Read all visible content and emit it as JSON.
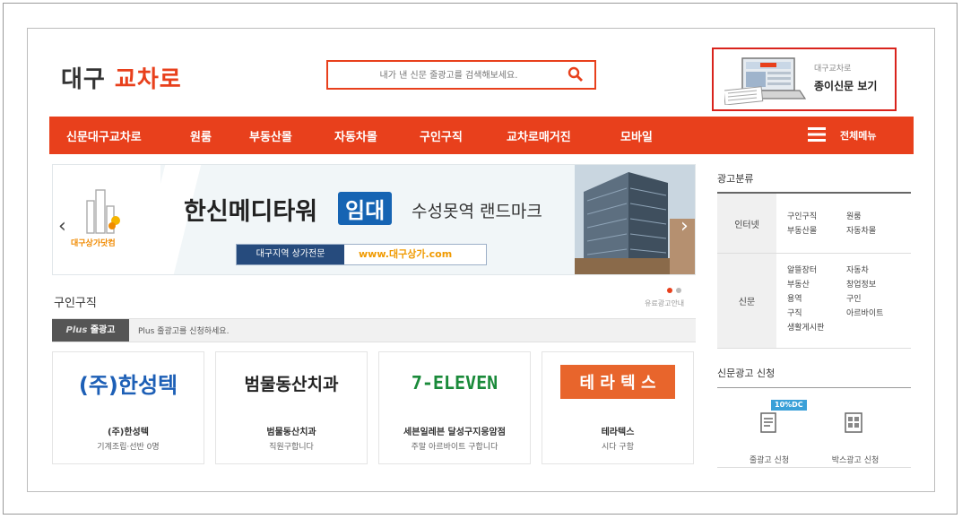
{
  "header": {
    "logo_part1": "대구",
    "logo_part2": "교차로",
    "search_placeholder": "내가 낸 신문 줄광고를 검색해보세요.",
    "paper_handwriting": "대구교차로",
    "paper_link": "종이신문 보기"
  },
  "nav": {
    "items": [
      "신문대구교차로",
      "원룸",
      "부동산몰",
      "자동차몰",
      "구인구직",
      "교차로매거진",
      "모바일"
    ],
    "all_menu": "전체메뉴"
  },
  "banner": {
    "headline": "한신메디타워",
    "rent_badge": "임대",
    "subline": "수성못역 랜드마크",
    "tag_label": "대구지역 상가전문",
    "tag_url": "www.대구상가.com",
    "logo_text": "대구상가닷컴"
  },
  "section": {
    "title": "구인구직",
    "link": "유료광고안내",
    "plus_badge_italic": "Plus",
    "plus_badge_text": "줄광고",
    "plus_text": "Plus 줄광고를 신청하세요."
  },
  "cards": [
    {
      "logo": "(주)한성텍",
      "name": "(주)한성텍",
      "desc": "기계조립·선반 0명"
    },
    {
      "logo": "범물동산치과",
      "name": "범물동산치과",
      "desc": "직원구합니다"
    },
    {
      "logo": "7-ELEVEN",
      "name": "세븐일레븐 달성구지응암점",
      "desc": "주말 아르바이트 구합니다"
    },
    {
      "logo": "테 라 텍 스",
      "name": "테라텍스",
      "desc": "시다 구함"
    }
  ],
  "sidebar": {
    "category_title": "광고분류",
    "groups": [
      {
        "label": "인터넷",
        "items": [
          "구인구직",
          "원룸",
          "부동산몰",
          "자동차몰"
        ]
      },
      {
        "label": "신문",
        "items": [
          "알뜰장터",
          "자동차",
          "부동산",
          "창업정보",
          "용역",
          "구인",
          "구직",
          "아르바이트",
          "생활게시판"
        ]
      }
    ],
    "apply_title": "신문광고 신청",
    "discount_badge": "10%DC",
    "apply_items": [
      "줄광고 신청",
      "박스광고 신청"
    ]
  },
  "colors": {
    "brand": "#e8401c",
    "paper_border": "#d9231c",
    "badge_blue": "#1664b3",
    "slide_dot_active": "#e8401c"
  }
}
